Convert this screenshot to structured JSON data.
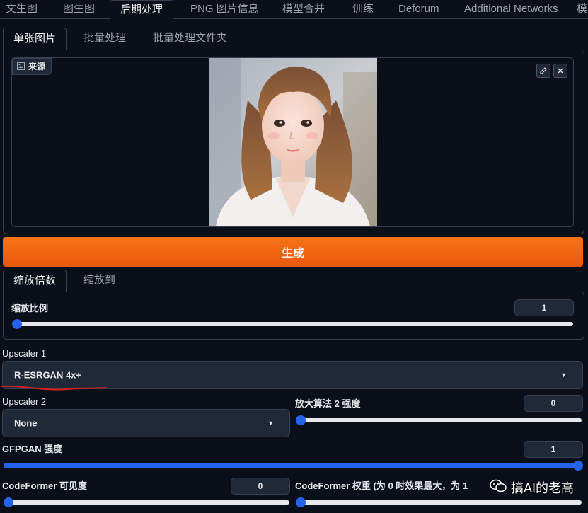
{
  "top_tabs": [
    {
      "label": "文生图"
    },
    {
      "label": "图生图"
    },
    {
      "label": "后期处理",
      "active": true
    },
    {
      "label": "PNG 图片信息"
    },
    {
      "label": "模型合并"
    },
    {
      "label": "训练"
    },
    {
      "label": "Deforum"
    },
    {
      "label": "Additional Networks"
    },
    {
      "label": "模"
    }
  ],
  "sub_tabs": [
    {
      "label": "单张图片",
      "active": true
    },
    {
      "label": "批量处理"
    },
    {
      "label": "批量处理文件夹"
    }
  ],
  "source": {
    "label": "来源",
    "icon": "image-icon"
  },
  "generate": {
    "label": "生成",
    "color": "#f97316"
  },
  "scale_tabs": [
    {
      "label": "缩放倍数",
      "active": true
    },
    {
      "label": "缩放到"
    }
  ],
  "resize": {
    "label": "缩放比例",
    "value": "1",
    "fill": 0
  },
  "upscaler1": {
    "label": "Upscaler 1",
    "value": "R-ESRGAN 4x+"
  },
  "upscaler2": {
    "label": "Upscaler 2",
    "value": "None"
  },
  "upscaler2_strength": {
    "label": "放大算法 2 强度",
    "value": "0",
    "fill": 0
  },
  "gfpgan": {
    "label": "GFPGAN 强度",
    "value": "1",
    "fill": 1
  },
  "codeformer_visibility": {
    "label": "CodeFormer 可见度",
    "value": "0",
    "fill": 0
  },
  "codeformer_weight": {
    "label": "CodeFormer 权重 (为 0 时效果最大，为 1"
  },
  "watermark": {
    "text": "搞AI的老高"
  },
  "accent_color": "#2563eb"
}
